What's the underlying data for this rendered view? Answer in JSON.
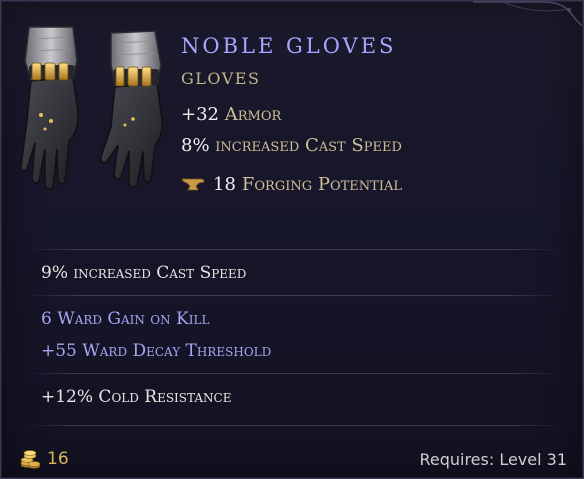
{
  "item": {
    "name": "Noble Gloves",
    "type": "Gloves",
    "icon": "gloves-icon",
    "name_color": "#a7a5ff",
    "type_color": "#c2b68e"
  },
  "implicits": [
    {
      "value": "+32",
      "label": "Armor"
    },
    {
      "value": "8%",
      "label": "increased Cast Speed"
    }
  ],
  "forging": {
    "icon": "anvil-icon",
    "value": "18",
    "label": "Forging Potential"
  },
  "affix_groups": [
    {
      "lines": [
        "9% increased Cast Speed"
      ],
      "color": "#e8e5e2"
    },
    {
      "lines": [
        "6 Ward Gain on Kill",
        "+55 Ward Decay Threshold"
      ],
      "color": "#a9a4f2"
    },
    {
      "lines": [
        "+12% Cold Resistance"
      ],
      "color": "#e8e5e2"
    }
  ],
  "footer": {
    "gold_icon": "gold-coins-icon",
    "gold": "16",
    "requirement": "Requires: Level 31"
  }
}
